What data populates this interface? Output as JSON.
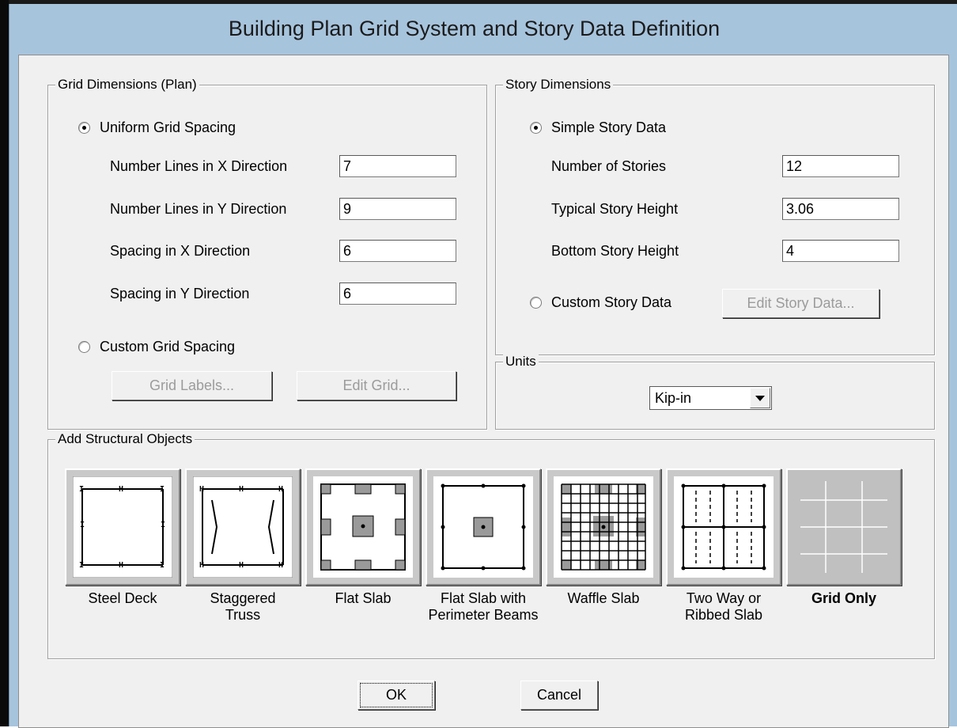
{
  "window": {
    "title": "Building Plan Grid System and Story Data Definition"
  },
  "grid_dimensions": {
    "legend": "Grid Dimensions (Plan)",
    "uniform_option": "Uniform Grid Spacing",
    "uniform_selected": true,
    "fields": [
      {
        "label": "Number Lines in X Direction",
        "value": "7"
      },
      {
        "label": "Number Lines in Y Direction",
        "value": "9"
      },
      {
        "label": "Spacing in X Direction",
        "value": "6"
      },
      {
        "label": "Spacing in Y Direction",
        "value": "6"
      }
    ],
    "custom_option": "Custom Grid Spacing",
    "custom_selected": false,
    "grid_labels_button": "Grid Labels...",
    "edit_grid_button": "Edit Grid..."
  },
  "story_dimensions": {
    "legend": "Story Dimensions",
    "simple_option": "Simple Story Data",
    "simple_selected": true,
    "fields": [
      {
        "label": "Number of Stories",
        "value": "12"
      },
      {
        "label": "Typical Story Height",
        "value": "3.06"
      },
      {
        "label": "Bottom Story Height",
        "value": "4"
      }
    ],
    "custom_option": "Custom Story Data",
    "custom_selected": false,
    "edit_story_button": "Edit Story Data..."
  },
  "units": {
    "legend": "Units",
    "selected": "Kip-in",
    "arrow_icon": "dropdown-arrow-icon"
  },
  "structural_objects": {
    "legend": "Add Structural Objects",
    "items": [
      {
        "label": "Steel Deck",
        "icon": "steel-deck-icon"
      },
      {
        "label": "Staggered\nTruss",
        "icon": "staggered-truss-icon"
      },
      {
        "label": "Flat Slab",
        "icon": "flat-slab-icon"
      },
      {
        "label": "Flat Slab with\nPerimeter Beams",
        "icon": "flat-slab-perimeter-beams-icon"
      },
      {
        "label": "Waffle Slab",
        "icon": "waffle-slab-icon"
      },
      {
        "label": "Two Way or\nRibbed Slab",
        "icon": "two-way-ribbed-slab-icon"
      },
      {
        "label": "Grid Only",
        "icon": "grid-only-icon",
        "selected": true
      }
    ]
  },
  "buttons": {
    "ok": "OK",
    "cancel": "Cancel"
  }
}
